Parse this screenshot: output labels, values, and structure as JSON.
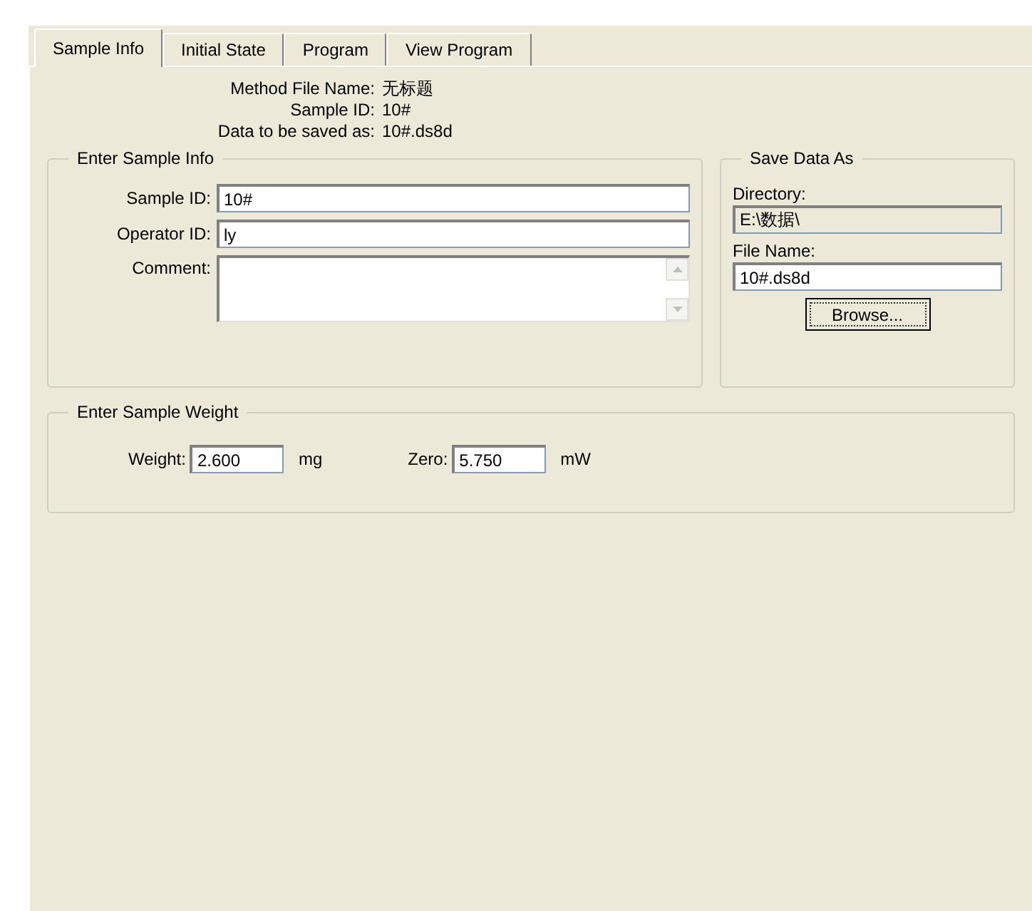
{
  "tabs": [
    {
      "label": "Sample Info",
      "selected": true
    },
    {
      "label": "Initial State",
      "selected": false
    },
    {
      "label": "Program",
      "selected": false
    },
    {
      "label": "View Program",
      "selected": false
    }
  ],
  "summary": [
    {
      "label": "Method File Name:",
      "value": "无标题"
    },
    {
      "label": "Sample ID:",
      "value": "10#"
    },
    {
      "label": "Data to be saved as:",
      "value": "10#.ds8d"
    }
  ],
  "sample_info": {
    "title": "Enter Sample Info",
    "sample_id": {
      "label": "Sample ID:",
      "value": "10#"
    },
    "operator_id": {
      "label": "Operator ID:",
      "value": "ly"
    },
    "comment": {
      "label": "Comment:"
    }
  },
  "save_data": {
    "title": "Save Data As",
    "directory": {
      "label": "Directory:",
      "value": "E:\\数据\\",
      "disabled": true
    },
    "file_name": {
      "label": "File Name:",
      "value": "10#.ds8d"
    },
    "browse": "Browse..."
  },
  "weight": {
    "title": "Enter Sample Weight",
    "fields": [
      {
        "label": "Weight:",
        "value": "2.600",
        "unit": "mg"
      },
      {
        "label": "Zero:",
        "value": "5.750",
        "unit": "mW"
      }
    ]
  }
}
